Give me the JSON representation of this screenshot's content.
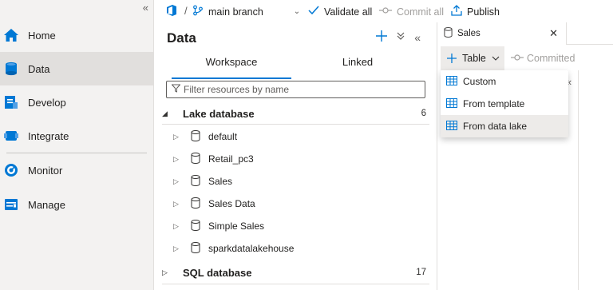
{
  "nav": {
    "items": [
      {
        "label": "Home"
      },
      {
        "label": "Data"
      },
      {
        "label": "Develop"
      },
      {
        "label": "Integrate"
      },
      {
        "label": "Monitor"
      },
      {
        "label": "Manage"
      }
    ],
    "active": "Data",
    "collapse_glyph": "«"
  },
  "toolbar": {
    "separator": "/",
    "branch": "main branch",
    "validate_all": "Validate all",
    "commit_all": "Commit all",
    "publish": "Publish"
  },
  "data_panel": {
    "title": "Data",
    "tabs": [
      {
        "label": "Workspace"
      },
      {
        "label": "Linked"
      }
    ],
    "active_tab": "Workspace",
    "filter_placeholder": "Filter resources by name",
    "groups": [
      {
        "label": "Lake database",
        "count": "6",
        "expanded": true
      },
      {
        "label": "SQL database",
        "count": "17",
        "expanded": false
      }
    ],
    "databases": [
      {
        "label": "default"
      },
      {
        "label": "Retail_pc3"
      },
      {
        "label": "Sales"
      },
      {
        "label": "Sales Data"
      },
      {
        "label": "Simple Sales"
      },
      {
        "label": "sparkdatalakehouse"
      }
    ]
  },
  "editor": {
    "tab_label": "Sales",
    "close_glyph": "✕",
    "table_button": "Table",
    "committed": "Committed",
    "side_chevron": "«"
  },
  "menu": {
    "items": [
      {
        "label": "Custom"
      },
      {
        "label": "From template"
      },
      {
        "label": "From data lake"
      }
    ],
    "hovered": "From data lake"
  },
  "colors": {
    "accent": "#0078d4",
    "nav_bg": "#f3f2f1",
    "nav_active": "#e1dfdd",
    "disabled_text": "#a19f9d"
  }
}
